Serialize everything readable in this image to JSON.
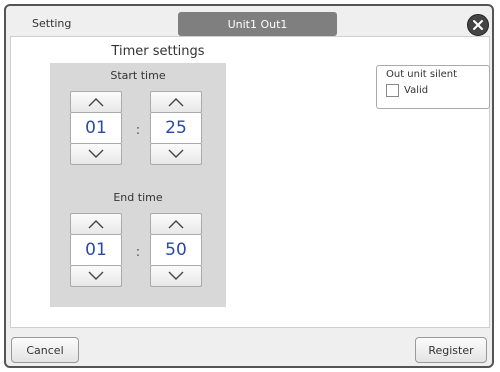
{
  "header": {
    "setting_label": "Setting",
    "title": "Unit1 Out1"
  },
  "timer": {
    "title": "Timer settings",
    "start": {
      "label": "Start time",
      "hour": "01",
      "minute": "25"
    },
    "end": {
      "label": "End time",
      "hour": "01",
      "minute": "50"
    },
    "separator": ":"
  },
  "silent": {
    "group_label": "Out unit silent",
    "checkbox_label": "Valid",
    "checked": false
  },
  "footer": {
    "cancel_label": "Cancel",
    "register_label": "Register"
  },
  "icons": {
    "close": "close-icon",
    "up": "chevron-up-icon",
    "down": "chevron-down-icon"
  },
  "colors": {
    "value_text": "#2b4aa6",
    "title_tab_bg": "#7f7f7f",
    "panel_bg": "#d8d8d8"
  }
}
